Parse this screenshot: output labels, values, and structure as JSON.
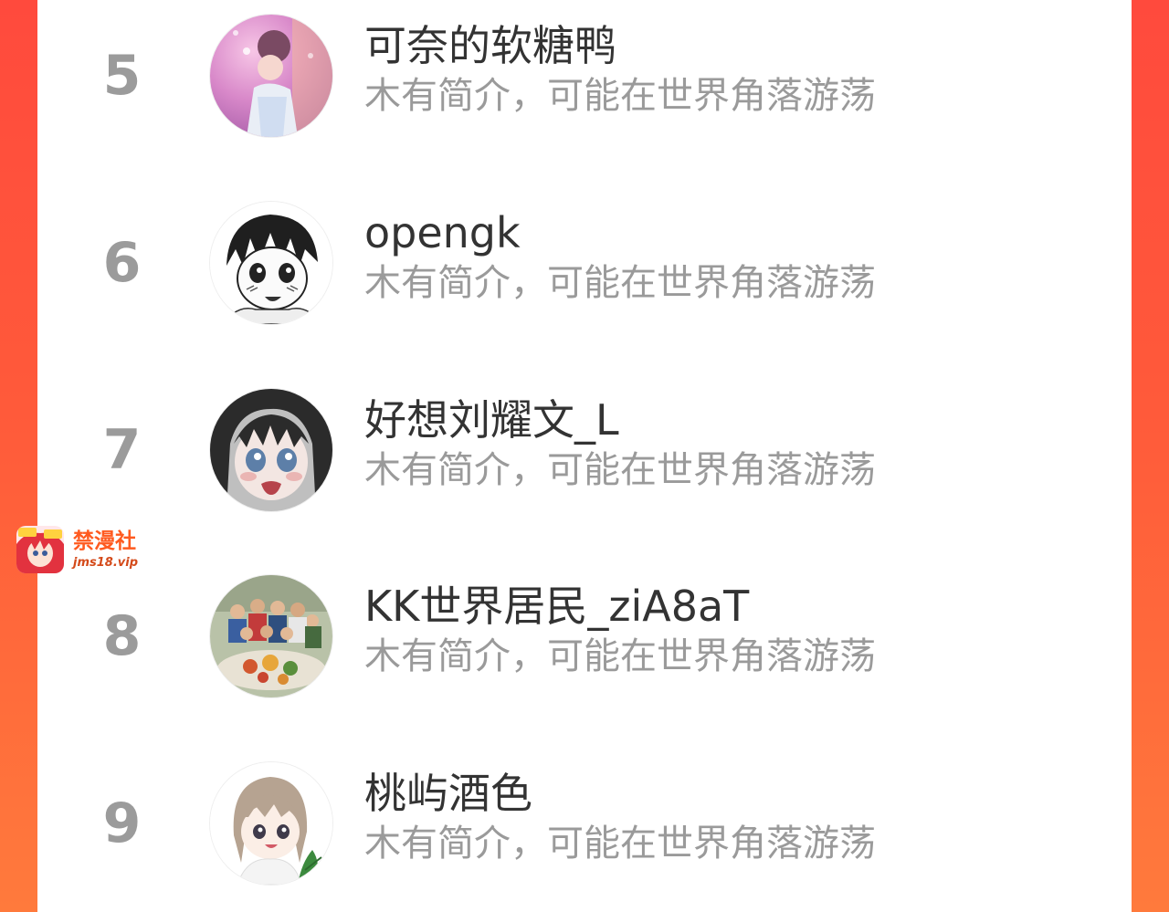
{
  "ranking": [
    {
      "rank": "5",
      "username": "可奈的软糖鸭",
      "bio": "木有简介，可能在世界角落游荡",
      "avatar_icon": "avatar-girl-pink-glow"
    },
    {
      "rank": "6",
      "username": "opengk",
      "bio": "木有简介，可能在世界角落游荡",
      "avatar_icon": "avatar-manga-boy-blushing"
    },
    {
      "rank": "7",
      "username": "好想刘耀文_L",
      "bio": "木有简介，可能在世界角落游荡",
      "avatar_icon": "avatar-anime-girl-crying"
    },
    {
      "rank": "8",
      "username": "KK世界居民_ziA8aT",
      "bio": "木有简介，可能在世界角落游荡",
      "avatar_icon": "avatar-group-photo"
    },
    {
      "rank": "9",
      "username": "桃屿酒色",
      "bio": "木有简介，可能在世界角落游荡",
      "avatar_icon": "avatar-chibi-girl"
    }
  ],
  "watermark": {
    "title": "禁漫社",
    "url": "jms18.vip",
    "icon": "app-logo-icon"
  },
  "colors": {
    "background_accent": "#ff4a3d",
    "rank_number": "#9b9b9b",
    "username": "#333333",
    "bio": "#9a9a9a",
    "watermark": "#ff5a1f"
  }
}
